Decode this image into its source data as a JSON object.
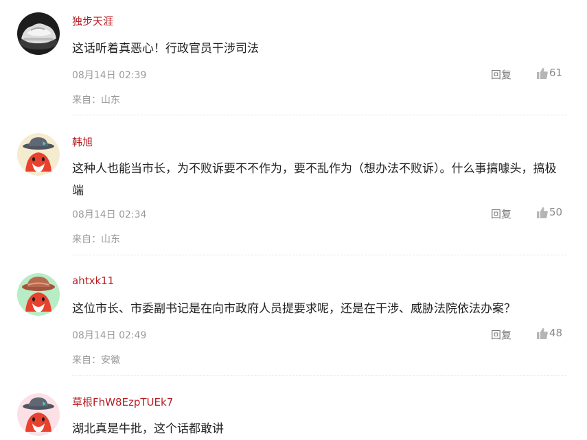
{
  "comments": [
    {
      "username": "独步天涯",
      "avatar": "car-photo-avatar",
      "content": "这话听着真恶心！行政官员干涉司法",
      "time": "08月14日 02:39",
      "reply_label": "回复",
      "likes": "61",
      "origin": "来自：山东"
    },
    {
      "username": "韩旭",
      "avatar": "fox-hat-avatar",
      "content": "这种人也能当市长，为不败诉要不不作为，要不乱作为（想办法不败诉）。什么事搞噱头，搞极端",
      "time": "08月14日 02:34",
      "reply_label": "回复",
      "likes": "50",
      "origin": "来自：山东"
    },
    {
      "username": "ahtxk11",
      "avatar": "fox-hat-avatar-green",
      "content": "这位市长、市委副书记是在向市政府人员提要求呢，还是在干涉、威胁法院依法办案？",
      "time": "08月14日 02:49",
      "reply_label": "回复",
      "likes": "48",
      "origin": "来自：安徽"
    },
    {
      "username": "草根FhW8EzpTUEk7",
      "avatar": "fox-hat-avatar-pink",
      "content": "湖北真是牛批，这个话都敢讲"
    }
  ],
  "colors": {
    "username": "#b81c22",
    "text": "#222222",
    "meta": "#9a9a9a"
  },
  "icons": {
    "like": "thumbs-up-icon"
  }
}
